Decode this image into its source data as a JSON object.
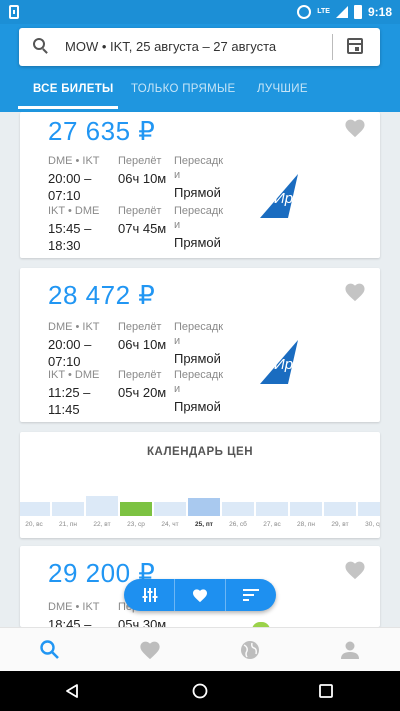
{
  "status_bar": {
    "time": "9:18",
    "network": "LTE"
  },
  "search": {
    "query": "MOW • IKT, 25 августа – 27 августа"
  },
  "tabs": [
    {
      "label": "ВСЕ БИЛЕТЫ",
      "active": true
    },
    {
      "label": "ТОЛЬКО ПРЯМЫЕ",
      "active": false
    },
    {
      "label": "ЛУЧШИЕ",
      "active": false
    }
  ],
  "tickets": [
    {
      "price": "27 635 ₽",
      "airline": "ИрАэро",
      "legs": [
        {
          "route": "DME • IKT",
          "times": "20:00 –\n07:10",
          "flight_label": "Перелёт",
          "duration": "06ч 10м",
          "transfer_label": "Пересадк\nи",
          "transfer": "Прямой"
        },
        {
          "route": "IKT • DME",
          "times": "15:45 –\n18:30",
          "flight_label": "Перелёт",
          "duration": "07ч 45м",
          "transfer_label": "Пересадк\nи",
          "transfer": "Прямой"
        }
      ]
    },
    {
      "price": "28 472 ₽",
      "airline": "ИрАэро",
      "legs": [
        {
          "route": "DME • IKT",
          "times": "20:00 –\n07:10",
          "flight_label": "Перелёт",
          "duration": "06ч 10м",
          "transfer_label": "Пересадк\nи",
          "transfer": "Прямой"
        },
        {
          "route": "IKT • DME",
          "times": "11:25 –\n11:45",
          "flight_label": "Перелёт",
          "duration": "05ч 20м",
          "transfer_label": "Пересадк\nи",
          "transfer": "Прямой"
        }
      ]
    },
    {
      "price": "29 200 ₽",
      "legs": [
        {
          "route": "DME • IKT",
          "times": "18:45 –",
          "flight_label": "Перелёт",
          "duration": "05ч 30м",
          "transfer_label": "и",
          "transfer": ""
        }
      ]
    }
  ],
  "price_calendar": {
    "title": "КАЛЕНДАРЬ ЦЕН",
    "days": [
      "20, вс",
      "21, пн",
      "22, вт",
      "23, ср",
      "24, чт",
      "25, пт",
      "26, сб",
      "27, вс",
      "28, пн",
      "29, вт",
      "30, ср"
    ],
    "levels": [
      0.55,
      0.55,
      0.75,
      0.55,
      0.55,
      0.7,
      0.55,
      0.55,
      0.55,
      0.55,
      0.55
    ],
    "selected_index": 5,
    "cheapest_index": 3
  },
  "colors": {
    "accent": "#1f96df",
    "price": "#2196f3",
    "cheapest": "#7cc242",
    "bar": "#dce9f7",
    "selected_bar": "#a9c9ef"
  },
  "icons": [
    "search-icon",
    "calendar-icon",
    "heart-icon",
    "filter-icon",
    "sort-icon",
    "globe-icon",
    "profile-icon"
  ]
}
